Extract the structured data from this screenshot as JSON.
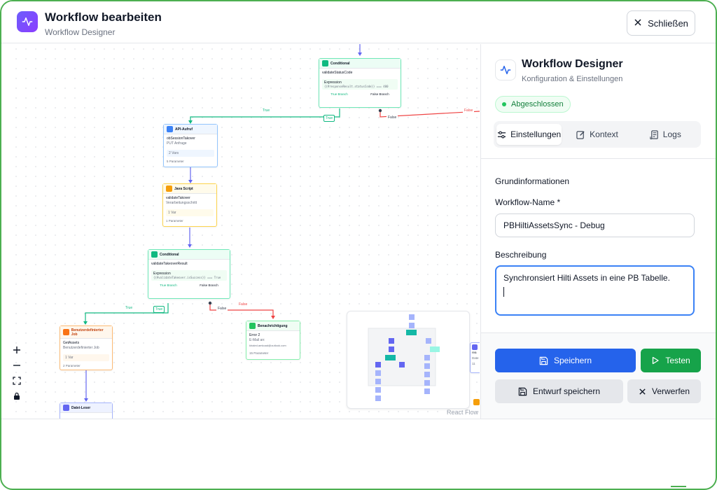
{
  "header": {
    "title": "Workflow bearbeiten",
    "subtitle": "Workflow Designer",
    "close_label": "Schließen"
  },
  "canvas": {
    "attribution": "React Flow",
    "nodes": {
      "conditional1": {
        "type": "Conditional",
        "name": "validateStatusCode",
        "expr_label": "Expression",
        "expr": "{{#responseResult.statusCode}} === 400",
        "true_branch": "True Branch",
        "false_branch": "False Branch"
      },
      "api": {
        "type": "API-Aufruf",
        "name": "obSessionTakover",
        "desc": "PUT Anfrage",
        "tag": "2 Vars",
        "foot": "5 Parameter"
      },
      "js": {
        "type": "Java Script",
        "name": "validateTakover",
        "desc": "Verarbeitungsschritt",
        "tag": "1 Var",
        "foot": "1 Parameter"
      },
      "conditional2": {
        "type": "Conditional",
        "name": "validateTakeoverResult",
        "expr_label": "Expression",
        "expr": "{{#validateTakeover.isSuccess}} === True",
        "true_branch": "True Branch",
        "false_branch": "False Branch"
      },
      "job": {
        "type": "Benutzerdefinierter Job",
        "name": "GetAssets",
        "desc": "Benutzerdefinierter Job",
        "tag": "1 Var",
        "foot": "2 Parameter"
      },
      "notify": {
        "type": "Benachrichtigung",
        "name": "Error 2",
        "desc": "E-Mail an:",
        "email": "khaled.amkoad@outlook.com",
        "foot": "15 Parameter"
      },
      "reader": {
        "type": "Datei-Leser"
      },
      "right_partial": {
        "line1": "rea",
        "line2": "Date",
        "line3": "11"
      }
    },
    "edge_labels": {
      "true": "True",
      "false": "False"
    }
  },
  "panel": {
    "title": "Workflow Designer",
    "subtitle": "Konfiguration & Einstellungen",
    "status": "Abgeschlossen",
    "tabs": [
      {
        "label": "Einstellungen",
        "icon": "sliders-icon"
      },
      {
        "label": "Kontext",
        "icon": "edit-icon"
      },
      {
        "label": "Logs",
        "icon": "scroll-icon"
      }
    ],
    "section_title": "Grundinformationen",
    "name_label": "Workflow-Name *",
    "name_value": "PBHiltiAssetsSync - Debug",
    "desc_label": "Beschreibung",
    "desc_value": "Synchronsiert Hilti Assets in eine PB Tabelle.",
    "buttons": {
      "save": "Speichern",
      "test": "Testen",
      "save_draft": "Entwurf speichern",
      "discard": "Verwerfen"
    }
  },
  "colors": {
    "accent": "#2563eb",
    "success": "#16a34a",
    "frame": "#4caf50",
    "true_edge": "#10b981",
    "false_edge": "#ef4444",
    "default_edge": "#6366f1"
  }
}
